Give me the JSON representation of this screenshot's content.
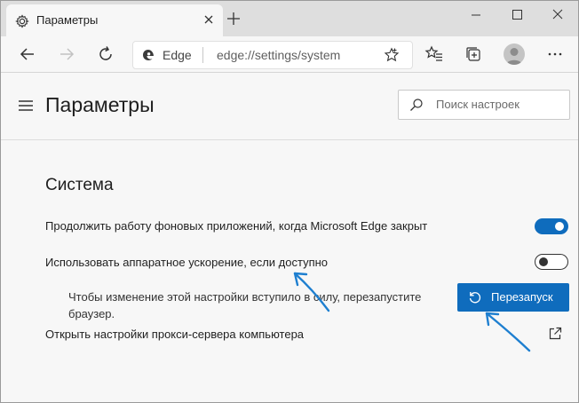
{
  "tab": {
    "title": "Параметры"
  },
  "toolbar": {
    "brand": "Edge",
    "url": "edge://settings/system"
  },
  "header": {
    "title": "Параметры",
    "search_placeholder": "Поиск настроек"
  },
  "section": {
    "title": "Система",
    "settings": [
      {
        "label": "Продолжить работу фоновых приложений, когда Microsoft Edge закрыт",
        "enabled": true
      },
      {
        "label": "Использовать аппаратное ускорение, если доступно",
        "enabled": false
      }
    ],
    "restart_hint": "Чтобы изменение этой настройки вступило в силу, перезапустите браузер.",
    "restart_label": "Перезапуск",
    "proxy_label": "Открыть настройки прокси-сервера компьютера"
  },
  "colors": {
    "accent": "#0f6cbd",
    "annotation": "#1e7fd0"
  },
  "icons": [
    "gear-icon",
    "close-icon",
    "plus-icon",
    "minimize-icon",
    "maximize-icon",
    "back-icon",
    "forward-icon",
    "refresh-icon",
    "edge-logo-icon",
    "star-icon",
    "favorites-icon",
    "collections-icon",
    "avatar",
    "more-icon",
    "hamburger-icon",
    "search-icon",
    "restart-icon",
    "external-link-icon"
  ]
}
